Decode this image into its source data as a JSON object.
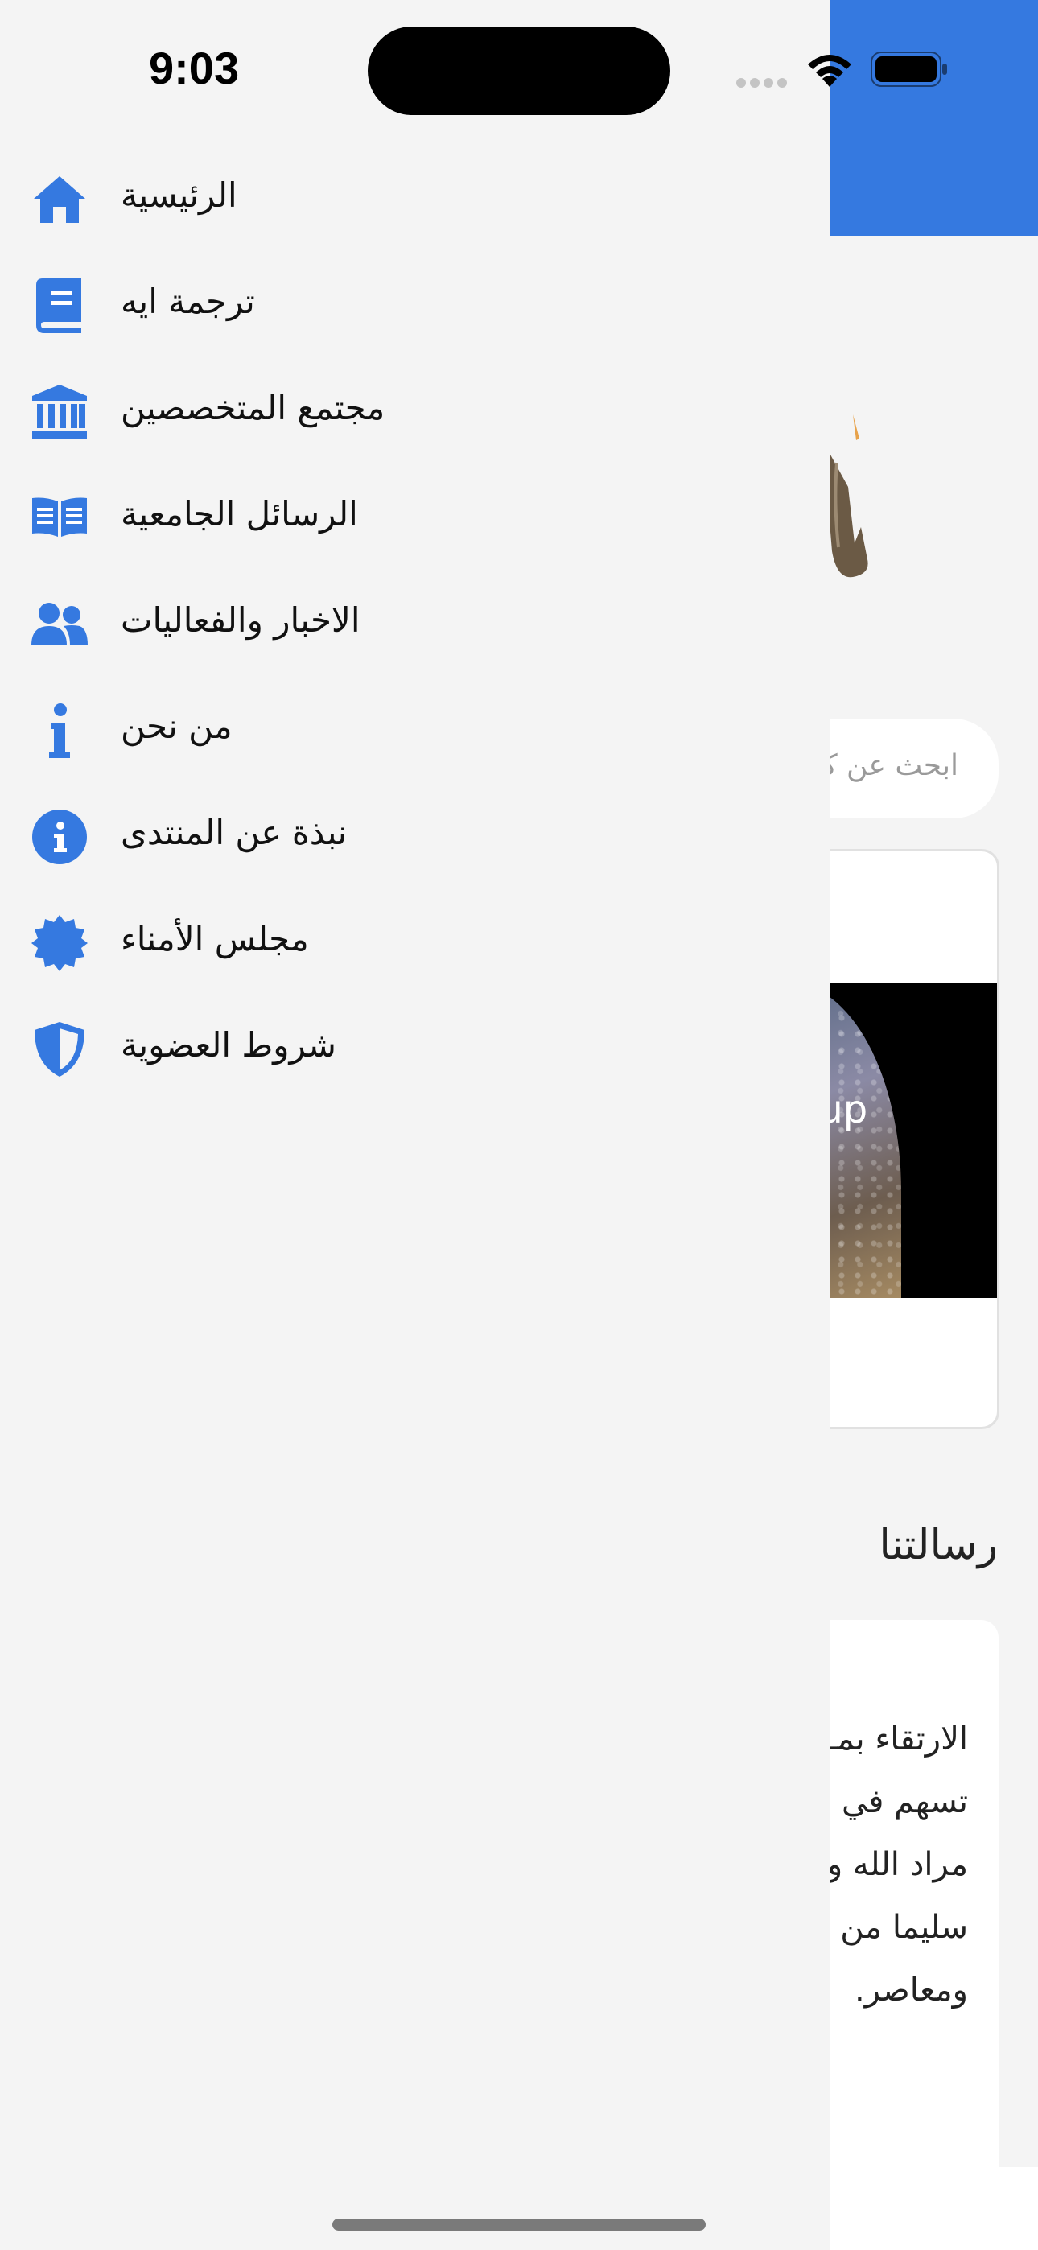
{
  "status_bar": {
    "time": "9:03"
  },
  "theme": {
    "accent": "#3579e0",
    "background": "#f4f4f4",
    "text": "#111111"
  },
  "drawer": {
    "items": [
      {
        "label": "الرئيسية",
        "icon": "home-icon"
      },
      {
        "label": "ترجمة ايه",
        "icon": "book-icon"
      },
      {
        "label": "مجتمع المتخصصين",
        "icon": "institution-icon"
      },
      {
        "label": "الرسائل الجامعية",
        "icon": "open-book-icon"
      },
      {
        "label": "الاخبار والفعاليات",
        "icon": "users-icon"
      },
      {
        "label": "من نحن",
        "icon": "info-icon"
      },
      {
        "label": "نبذة عن المنتدى",
        "icon": "info-circle-icon"
      },
      {
        "label": "مجلس الأمناء",
        "icon": "certificate-icon"
      },
      {
        "label": "شروط العضوية",
        "icon": "shield-icon"
      }
    ]
  },
  "background_page": {
    "search_placeholder": "ابحث عن كـ",
    "card_overlay_text": "oup",
    "section_title": "رسالتنا",
    "message_lines": [
      "الارتقاء بمـ",
      "تسهم في",
      "مراد الله و",
      "سليما من",
      "ومعاصر."
    ]
  }
}
